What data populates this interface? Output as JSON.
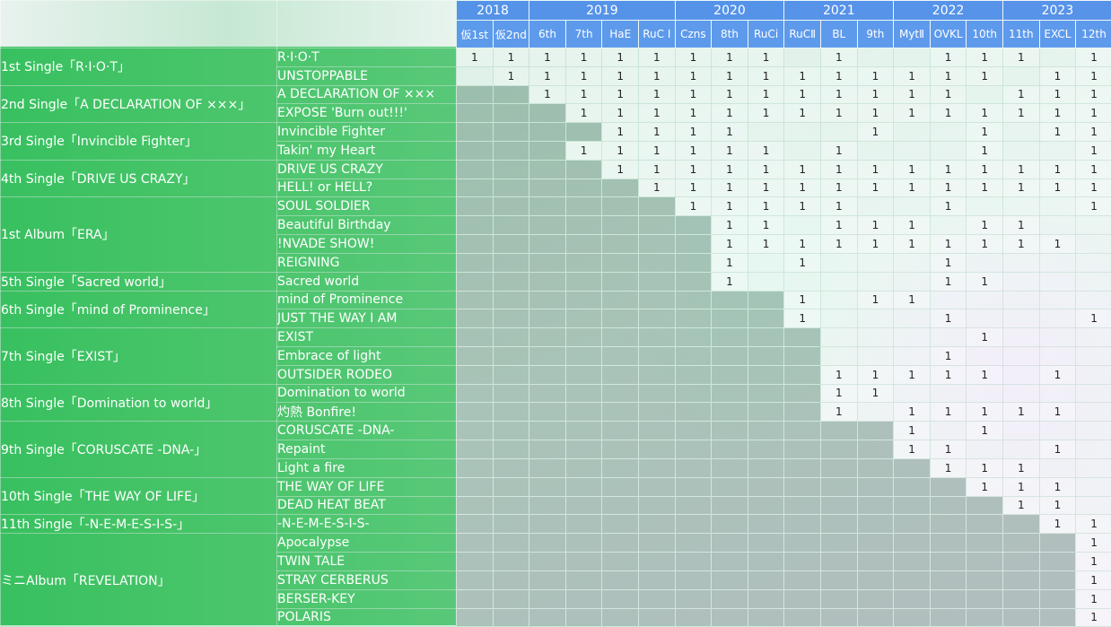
{
  "years": [
    {
      "label": "2018",
      "span": 2
    },
    {
      "label": "2019",
      "span": 4
    },
    {
      "label": "2020",
      "span": 3
    },
    {
      "label": "2021",
      "span": 3
    },
    {
      "label": "2022",
      "span": 3
    },
    {
      "label": "2023",
      "span": 3
    }
  ],
  "events": [
    "仮1st",
    "仮2nd",
    "6th",
    "7th",
    "HaE",
    "RuC Ⅰ",
    "Czns",
    "8th",
    "RuCi",
    "RuCⅡ",
    "BL",
    "9th",
    "MytⅡ",
    "OVKL",
    "10th",
    "11th",
    "EXCL",
    "12th"
  ],
  "releases": [
    {
      "label": "1st Single「R·I·O·T」",
      "span": 2
    },
    {
      "label": "2nd Single「A DECLARATION OF ×××」",
      "span": 2
    },
    {
      "label": "3rd Single「Invincible Fighter」",
      "span": 2
    },
    {
      "label": "4th Single「DRIVE US CRAZY」",
      "span": 2
    },
    {
      "label": "1st Album「ERA」",
      "span": 4
    },
    {
      "label": "5th Single「Sacred world」",
      "span": 1
    },
    {
      "label": "6th Single「mind of Prominence」",
      "span": 2
    },
    {
      "label": "7th Single「EXIST」",
      "span": 3
    },
    {
      "label": "8th Single「Domination to world」",
      "span": 2
    },
    {
      "label": "9th Single「CORUSCATE -DNA-」",
      "span": 3
    },
    {
      "label": "10th Single「THE WAY OF LIFE」",
      "span": 2
    },
    {
      "label": "11th Single「-N-E-M-E-S-I-S-」",
      "span": 1
    },
    {
      "label": "ミニAlbum「REVELATION」",
      "span": 6
    }
  ],
  "songs": [
    {
      "title": "R·I·O·T",
      "start": 0,
      "cells": [
        "1",
        "1",
        "1",
        "1",
        "1",
        "1",
        "1",
        "1",
        "1",
        "",
        "1",
        "",
        "",
        "1",
        "1",
        "1",
        "",
        "1"
      ]
    },
    {
      "title": "UNSTOPPABLE",
      "start": 0,
      "cells": [
        "",
        "1",
        "1",
        "1",
        "1",
        "1",
        "1",
        "1",
        "1",
        "1",
        "1",
        "1",
        "1",
        "1",
        "1",
        "",
        "1",
        "1"
      ]
    },
    {
      "title": "A DECLARATION OF ×××",
      "start": 2,
      "cells": [
        "",
        "",
        "1",
        "1",
        "1",
        "1",
        "1",
        "1",
        "1",
        "1",
        "1",
        "1",
        "1",
        "1",
        "",
        "1",
        "1",
        "1"
      ]
    },
    {
      "title": "EXPOSE 'Burn out!!!'",
      "start": 3,
      "cells": [
        "",
        "",
        "",
        "1",
        "1",
        "1",
        "1",
        "1",
        "1",
        "1",
        "1",
        "1",
        "1",
        "1",
        "1",
        "1",
        "1",
        "1"
      ]
    },
    {
      "title": "Invincible Fighter",
      "start": 4,
      "cells": [
        "",
        "",
        "",
        "",
        "1",
        "1",
        "1",
        "1",
        "",
        "",
        "",
        "1",
        "",
        "",
        "1",
        "",
        "1",
        "1"
      ]
    },
    {
      "title": "Takin' my Heart",
      "start": 3,
      "cells": [
        "",
        "",
        "",
        "1",
        "1",
        "1",
        "1",
        "1",
        "1",
        "",
        "1",
        "",
        "",
        "",
        "1",
        "",
        "",
        "1"
      ]
    },
    {
      "title": "DRIVE US CRAZY",
      "start": 4,
      "cells": [
        "",
        "",
        "",
        "",
        "1",
        "1",
        "1",
        "1",
        "1",
        "1",
        "1",
        "1",
        "1",
        "1",
        "1",
        "1",
        "1",
        "1"
      ]
    },
    {
      "title": "HELL! or HELL?",
      "start": 5,
      "cells": [
        "",
        "",
        "",
        "",
        "",
        "1",
        "1",
        "1",
        "1",
        "1",
        "1",
        "1",
        "1",
        "1",
        "1",
        "1",
        "1",
        "1"
      ]
    },
    {
      "title": "SOUL SOLDIER",
      "start": 6,
      "cells": [
        "",
        "",
        "",
        "",
        "",
        "",
        "1",
        "1",
        "1",
        "1",
        "1",
        "",
        "",
        "1",
        "",
        "",
        "",
        "1"
      ]
    },
    {
      "title": "Beautiful Birthday",
      "start": 7,
      "cells": [
        "",
        "",
        "",
        "",
        "",
        "",
        "",
        "1",
        "1",
        "",
        "1",
        "1",
        "1",
        "",
        "1",
        "1",
        "",
        ""
      ]
    },
    {
      "title": "!NVADE SHOW!",
      "start": 7,
      "cells": [
        "",
        "",
        "",
        "",
        "",
        "",
        "",
        "1",
        "1",
        "1",
        "1",
        "1",
        "1",
        "1",
        "1",
        "1",
        "1",
        ""
      ]
    },
    {
      "title": "REIGNING",
      "start": 7,
      "cells": [
        "",
        "",
        "",
        "",
        "",
        "",
        "",
        "1",
        "",
        "1",
        "",
        "",
        "",
        "1",
        "",
        "",
        "",
        ""
      ]
    },
    {
      "title": "Sacred world",
      "start": 7,
      "cells": [
        "",
        "",
        "",
        "",
        "",
        "",
        "",
        "1",
        "",
        "",
        "",
        "",
        "",
        "1",
        "1",
        "",
        "",
        ""
      ]
    },
    {
      "title": "mind of Prominence",
      "start": 9,
      "cells": [
        "",
        "",
        "",
        "",
        "",
        "",
        "",
        "",
        "",
        "1",
        "",
        "1",
        "1",
        "",
        "",
        "",
        "",
        ""
      ]
    },
    {
      "title": "JUST THE WAY I AM",
      "start": 9,
      "cells": [
        "",
        "",
        "",
        "",
        "",
        "",
        "",
        "",
        "",
        "1",
        "",
        "",
        "",
        "1",
        "",
        "",
        "",
        "1"
      ]
    },
    {
      "title": "EXIST",
      "start": 10,
      "cells": [
        "",
        "",
        "",
        "",
        "",
        "",
        "",
        "",
        "",
        "",
        "",
        "",
        "",
        "",
        "1",
        "",
        "",
        ""
      ]
    },
    {
      "title": "Embrace of light",
      "start": 10,
      "cells": [
        "",
        "",
        "",
        "",
        "",
        "",
        "",
        "",
        "",
        "",
        "",
        "",
        "",
        "1",
        "",
        "",
        "",
        ""
      ]
    },
    {
      "title": "OUTSIDER RODEO",
      "start": 10,
      "cells": [
        "",
        "",
        "",
        "",
        "",
        "",
        "",
        "",
        "",
        "",
        "1",
        "1",
        "1",
        "1",
        "1",
        "",
        "1",
        ""
      ]
    },
    {
      "title": "Domination to world",
      "start": 10,
      "cells": [
        "",
        "",
        "",
        "",
        "",
        "",
        "",
        "",
        "",
        "",
        "1",
        "1",
        "",
        "",
        "",
        "",
        "",
        ""
      ]
    },
    {
      "title": "灼熱 Bonfire!",
      "start": 10,
      "cells": [
        "",
        "",
        "",
        "",
        "",
        "",
        "",
        "",
        "",
        "",
        "1",
        "",
        "1",
        "1",
        "1",
        "1",
        "1",
        ""
      ]
    },
    {
      "title": "CORUSCATE -DNA-",
      "start": 12,
      "cells": [
        "",
        "",
        "",
        "",
        "",
        "",
        "",
        "",
        "",
        "",
        "",
        "",
        "1",
        "",
        "1",
        "",
        "",
        ""
      ]
    },
    {
      "title": "Repaint",
      "start": 12,
      "cells": [
        "",
        "",
        "",
        "",
        "",
        "",
        "",
        "",
        "",
        "",
        "",
        "",
        "1",
        "1",
        "",
        "",
        "1",
        ""
      ]
    },
    {
      "title": "Light a fire",
      "start": 13,
      "cells": [
        "",
        "",
        "",
        "",
        "",
        "",
        "",
        "",
        "",
        "",
        "",
        "",
        "",
        "1",
        "1",
        "1",
        "",
        ""
      ]
    },
    {
      "title": "THE WAY OF LIFE",
      "start": 14,
      "cells": [
        "",
        "",
        "",
        "",
        "",
        "",
        "",
        "",
        "",
        "",
        "",
        "",
        "",
        "",
        "1",
        "1",
        "1",
        ""
      ]
    },
    {
      "title": "DEAD HEAT BEAT",
      "start": 15,
      "cells": [
        "",
        "",
        "",
        "",
        "",
        "",
        "",
        "",
        "",
        "",
        "",
        "",
        "",
        "",
        "",
        "1",
        "1",
        ""
      ]
    },
    {
      "title": "-N-E-M-E-S-I-S-",
      "start": 16,
      "cells": [
        "",
        "",
        "",
        "",
        "",
        "",
        "",
        "",
        "",
        "",
        "",
        "",
        "",
        "",
        "",
        "",
        "1",
        "1"
      ]
    },
    {
      "title": "Apocalypse",
      "start": 17,
      "cells": [
        "",
        "",
        "",
        "",
        "",
        "",
        "",
        "",
        "",
        "",
        "",
        "",
        "",
        "",
        "",
        "",
        "",
        "1"
      ]
    },
    {
      "title": "TWIN TALE",
      "start": 17,
      "cells": [
        "",
        "",
        "",
        "",
        "",
        "",
        "",
        "",
        "",
        "",
        "",
        "",
        "",
        "",
        "",
        "",
        "",
        "1"
      ]
    },
    {
      "title": "STRAY CERBERUS",
      "start": 17,
      "cells": [
        "",
        "",
        "",
        "",
        "",
        "",
        "",
        "",
        "",
        "",
        "",
        "",
        "",
        "",
        "",
        "",
        "",
        "1"
      ]
    },
    {
      "title": "BERSER-KEY",
      "start": 17,
      "cells": [
        "",
        "",
        "",
        "",
        "",
        "",
        "",
        "",
        "",
        "",
        "",
        "",
        "",
        "",
        "",
        "",
        "",
        "1"
      ]
    },
    {
      "title": "POLARIS",
      "start": 17,
      "cells": [
        "",
        "",
        "",
        "",
        "",
        "",
        "",
        "",
        "",
        "",
        "",
        "",
        "",
        "",
        "",
        "",
        "",
        "1"
      ]
    }
  ]
}
